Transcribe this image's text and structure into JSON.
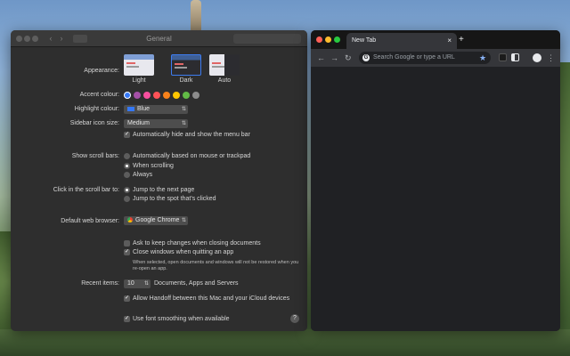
{
  "prefs": {
    "title": "General",
    "appearance": {
      "label": "Appearance:",
      "options": [
        {
          "name": "Light"
        },
        {
          "name": "Dark",
          "selected": true
        },
        {
          "name": "Auto"
        }
      ]
    },
    "accent": {
      "label": "Accent colour:",
      "colors": [
        "#3478f6",
        "#a550a7",
        "#f74f9e",
        "#ff5257",
        "#f7821b",
        "#ffc600",
        "#62ba46",
        "#8c8c8c"
      ]
    },
    "highlight": {
      "label": "Highlight colour:",
      "value": "Blue",
      "swatch": "#3478f6"
    },
    "sidebar_icon": {
      "label": "Sidebar icon size:",
      "value": "Medium"
    },
    "menu_bar": {
      "label": "Automatically hide and show the menu bar",
      "checked": true
    },
    "scroll_bars": {
      "label": "Show scroll bars:",
      "options": [
        "Automatically based on mouse or trackpad",
        "When scrolling",
        "Always"
      ],
      "selected": 1
    },
    "click_scroll": {
      "label": "Click in the scroll bar to:",
      "options": [
        "Jump to the next page",
        "Jump to the spot that's clicked"
      ],
      "selected": 0
    },
    "browser": {
      "label": "Default web browser:",
      "value": "Google Chrome"
    },
    "ask_keep": {
      "label": "Ask to keep changes when closing documents",
      "checked": false
    },
    "close_windows": {
      "label": "Close windows when quitting an app",
      "checked": true,
      "note": "When selected, open documents and windows will not be restored when you re-open an app."
    },
    "recent": {
      "label": "Recent items:",
      "value": "10",
      "suffix": "Documents, Apps and Servers"
    },
    "handoff": {
      "label": "Allow Handoff between this Mac and your iCloud devices",
      "checked": true
    },
    "font_smoothing": {
      "label": "Use font smoothing when available",
      "checked": true
    },
    "help": "?"
  },
  "chrome": {
    "tab_title": "New Tab",
    "tab_close": "×",
    "new_tab": "+",
    "omnibox_placeholder": "Search Google or type a URL",
    "google_letter": "G"
  }
}
